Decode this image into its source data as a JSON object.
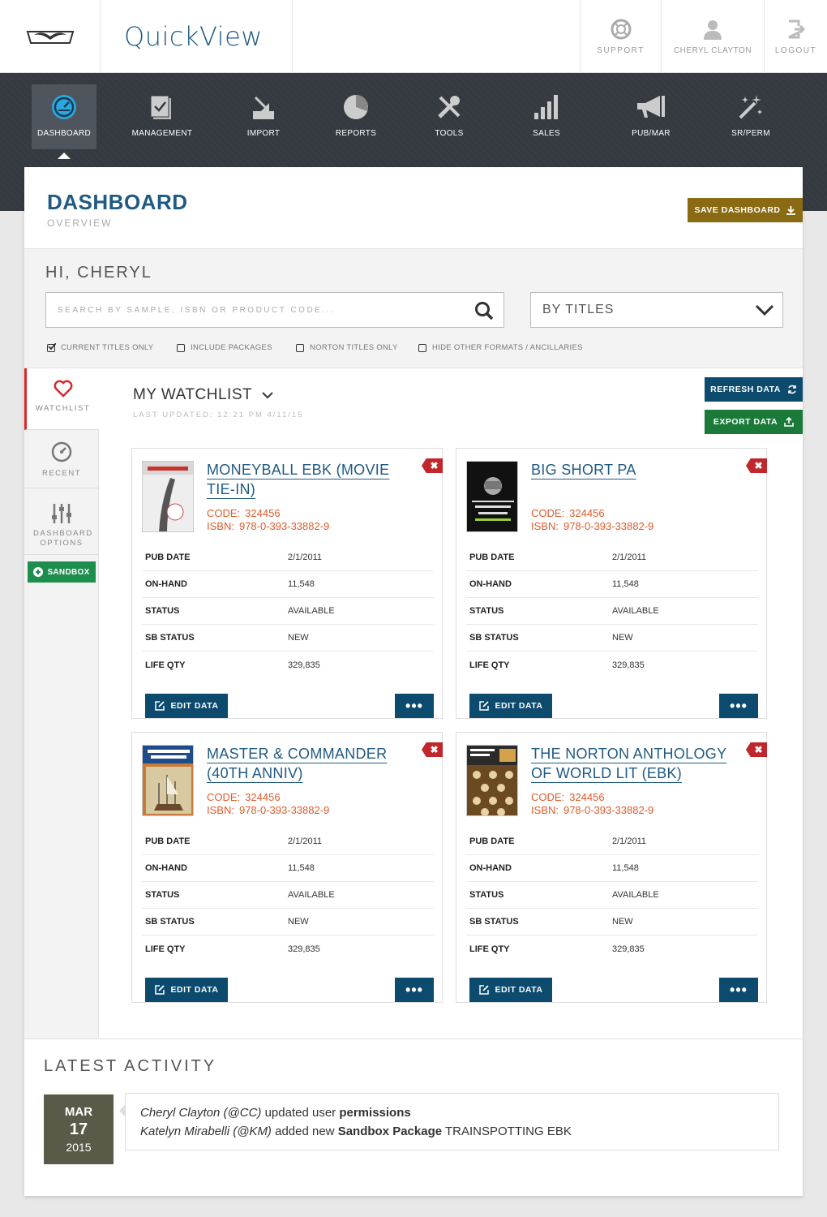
{
  "app": {
    "title": "QuickView"
  },
  "top_actions": [
    {
      "label": "SUPPORT",
      "icon": "support-icon"
    },
    {
      "label": "CHERYL CLAYTON",
      "icon": "user-icon"
    },
    {
      "label": "LOGOUT",
      "icon": "logout-icon"
    }
  ],
  "nav": [
    {
      "label": "DASHBOARD",
      "icon": "dashboard-gauge-icon",
      "active": true
    },
    {
      "label": "MANAGEMENT",
      "icon": "management-icon"
    },
    {
      "label": "IMPORT",
      "icon": "import-icon"
    },
    {
      "label": "REPORTS",
      "icon": "reports-pie-icon"
    },
    {
      "label": "TOOLS",
      "icon": "tools-icon"
    },
    {
      "label": "SALES",
      "icon": "sales-bars-icon"
    },
    {
      "label": "PUB/MAR",
      "icon": "megaphone-icon"
    },
    {
      "label": "SR/PERM",
      "icon": "magic-wand-icon"
    }
  ],
  "dashboard": {
    "title": "DASHBOARD",
    "subtitle": "OVERVIEW",
    "save_label": "SAVE DASHBOARD"
  },
  "greeting": "HI, CHERYL",
  "search": {
    "placeholder": "SEARCH BY SAMPLE, ISBN OR PRODUCT CODE...",
    "value": ""
  },
  "filter_select": {
    "value": "BY TITLES"
  },
  "checkboxes": [
    {
      "label": "CURRENT TITLES ONLY",
      "checked": true
    },
    {
      "label": "INCLUDE PACKAGES",
      "checked": false
    },
    {
      "label": "NORTON TITLES ONLY",
      "checked": false
    },
    {
      "label": "HIDE OTHER FORMATS / ANCILLARIES",
      "checked": false
    }
  ],
  "sidebar": {
    "items": [
      {
        "label": "WATCHLIST",
        "icon": "heart-icon"
      },
      {
        "label": "RECENT",
        "icon": "clock-icon"
      },
      {
        "label": "DASHBOARD OPTIONS",
        "icon": "sliders-icon"
      }
    ],
    "sandbox_label": "SANDBOX"
  },
  "watchlist": {
    "title": "MY WATCHLIST",
    "updated": "LAST UPDATED: 12:21 PM 4/11/15",
    "refresh_label": "REFRESH DATA",
    "export_label": "EXPORT DATA"
  },
  "field_labels": {
    "code": "CODE:",
    "isbn": "ISBN:",
    "edit": "EDIT DATA",
    "more": "•••",
    "remove": "✖"
  },
  "cards": [
    {
      "title": "MONEYBALL EBK (MOVIE TIE-IN)",
      "code": "324456",
      "isbn": "978-0-393-33882-9",
      "rows": [
        {
          "k": "PUB DATE",
          "v": "2/1/2011"
        },
        {
          "k": "ON-HAND",
          "v": "11,548"
        },
        {
          "k": "STATUS",
          "v": "AVAILABLE"
        },
        {
          "k": "SB STATUS",
          "v": "NEW"
        },
        {
          "k": "LIFE QTY",
          "v": "329,835"
        }
      ]
    },
    {
      "title": "BIG SHORT PA",
      "code": "324456",
      "isbn": "978-0-393-33882-9",
      "rows": [
        {
          "k": "PUB DATE",
          "v": "2/1/2011"
        },
        {
          "k": "ON-HAND",
          "v": "11,548"
        },
        {
          "k": "STATUS",
          "v": "AVAILABLE"
        },
        {
          "k": "SB STATUS",
          "v": "NEW"
        },
        {
          "k": "LIFE QTY",
          "v": "329,835"
        }
      ]
    },
    {
      "title": "MASTER & COMMANDER (40TH ANNIV)",
      "code": "324456",
      "isbn": "978-0-393-33882-9",
      "rows": [
        {
          "k": "PUB DATE",
          "v": "2/1/2011"
        },
        {
          "k": "ON-HAND",
          "v": "11,548"
        },
        {
          "k": "STATUS",
          "v": "AVAILABLE"
        },
        {
          "k": "SB STATUS",
          "v": "NEW"
        },
        {
          "k": "LIFE QTY",
          "v": "329,835"
        }
      ]
    },
    {
      "title": "THE NORTON ANTHOLOGY OF WORLD LIT (EBK)",
      "code": "324456",
      "isbn": "978-0-393-33882-9",
      "rows": [
        {
          "k": "PUB DATE",
          "v": "2/1/2011"
        },
        {
          "k": "ON-HAND",
          "v": "11,548"
        },
        {
          "k": "STATUS",
          "v": "AVAILABLE"
        },
        {
          "k": "SB STATUS",
          "v": "NEW"
        },
        {
          "k": "LIFE QTY",
          "v": "329,835"
        }
      ]
    }
  ],
  "activity": {
    "title": "LATEST ACTIVITY",
    "date": {
      "month": "MAR",
      "day": "17",
      "year": "2015"
    },
    "entries": [
      {
        "user": "Cheryl Clayton (@CC)",
        "action": "updated user",
        "object": "permissions",
        "extra": ""
      },
      {
        "user": "Katelyn Mirabelli (@KM)",
        "action": "added new",
        "object": "Sandbox Package",
        "extra": "TRAINSPOTTING EBK"
      }
    ]
  },
  "colors": {
    "brand_blue": "#1f5a84",
    "nav_dark": "#343a40",
    "button_blue": "#0c4a6e",
    "save_gold": "#8a6a12",
    "export_green": "#1a7a3a",
    "sandbox_green": "#1e8e4e",
    "accent_red": "#c0262b",
    "meta_orange": "#e05a2a"
  }
}
